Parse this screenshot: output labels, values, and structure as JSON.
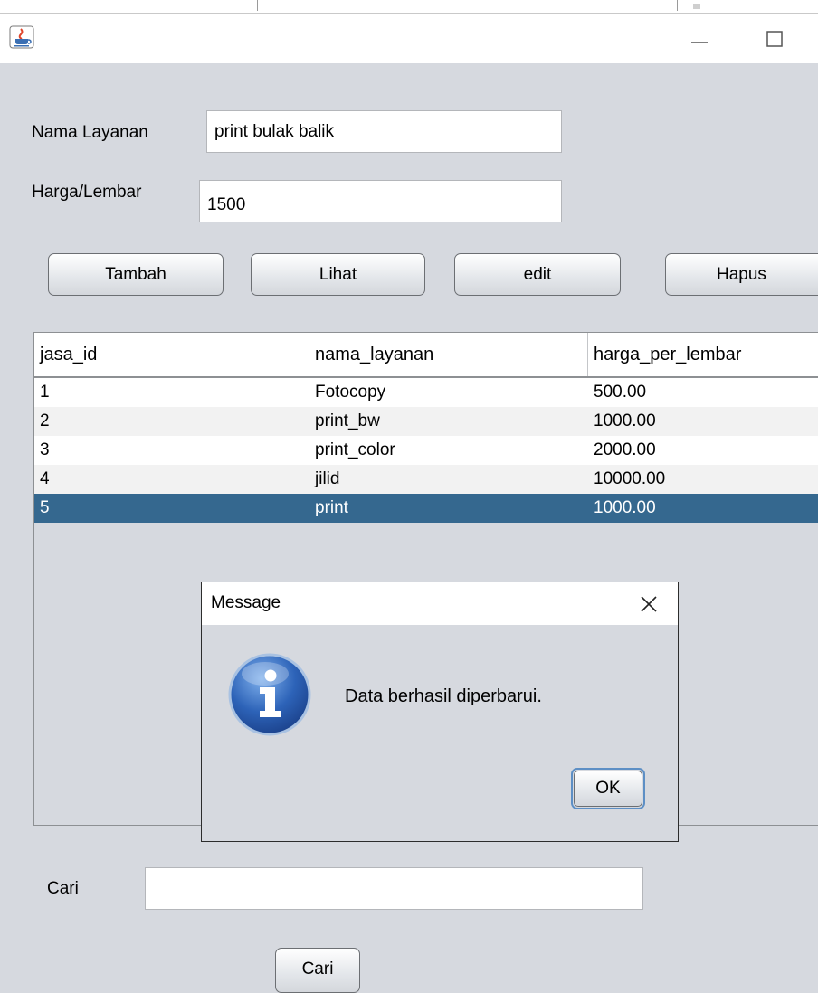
{
  "window": {
    "app_icon": "java-coffee-icon",
    "minimize_icon": "minimize-icon",
    "maximize_icon": "maximize-icon"
  },
  "form": {
    "nama_layanan_label": "Nama Layanan",
    "nama_layanan_value": "print bulak balik",
    "harga_label": "Harga/Lembar",
    "harga_value": "1500"
  },
  "buttons": {
    "tambah": "Tambah",
    "lihat": "Lihat",
    "edit": "edit",
    "hapus": "Hapus"
  },
  "table": {
    "columns": [
      "jasa_id",
      "nama_layanan",
      "harga_per_lembar"
    ],
    "rows": [
      [
        "1",
        "Fotocopy",
        "500.00"
      ],
      [
        "2",
        "print_bw",
        "1000.00"
      ],
      [
        "3",
        "print_color",
        "2000.00"
      ],
      [
        "4",
        "jilid",
        "10000.00"
      ],
      [
        "5",
        "print",
        "1000.00"
      ]
    ],
    "selected_row_index": 4,
    "selected_color": "#35688f",
    "alt_row_color": "#f2f2f2"
  },
  "dialog": {
    "title": "Message",
    "message": "Data berhasil diperbarui.",
    "ok_label": "OK",
    "icon": "information-icon",
    "close_icon": "close-icon"
  },
  "search": {
    "label": "Cari",
    "value": "",
    "button_label": "Cari"
  }
}
